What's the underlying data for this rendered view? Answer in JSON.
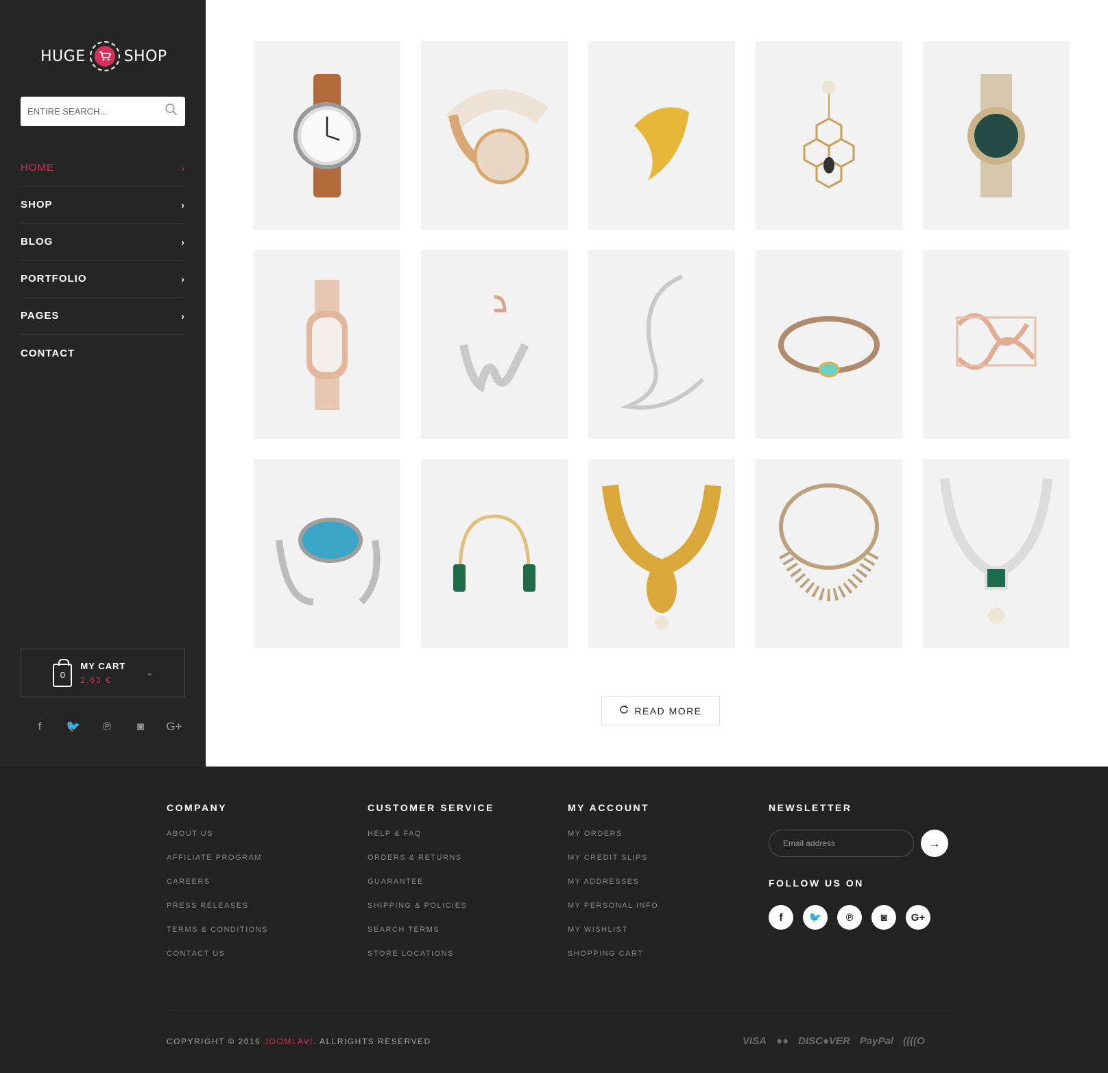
{
  "sidebar": {
    "logo": {
      "left": "HUGE",
      "right": "SHOP"
    },
    "search": {
      "placeholder": "ENTIRE SEARCH..."
    },
    "nav": [
      {
        "label": "HOME",
        "chevron": "›"
      },
      {
        "label": "SHOP",
        "chevron": "›"
      },
      {
        "label": "BLOG",
        "chevron": "›"
      },
      {
        "label": "PORTFOLIO",
        "chevron": "›"
      },
      {
        "label": "PAGES",
        "chevron": "›"
      },
      {
        "label": "CONTACT",
        "chevron": ""
      }
    ],
    "cart": {
      "title": "MY CART",
      "total": "2,63 €",
      "count": "0"
    },
    "social": [
      "f",
      "🐦",
      "℗",
      "◙",
      "G+"
    ]
  },
  "products": [
    "watch-leather",
    "watch-white-strap",
    "gold-cuff",
    "bee-earring",
    "green-dial-watch",
    "rose-gold-watch",
    "w-charm",
    "ear-cuff",
    "turquoise-bracelet",
    "rose-gold-ring",
    "turquoise-cuff",
    "malachite-bangle",
    "gold-necklace",
    "diamond-necklace",
    "emerald-necklace"
  ],
  "read_more": {
    "label": "READ MORE"
  },
  "footer": {
    "company": {
      "title": "COMPANY",
      "items": [
        "ABOUT US",
        "AFFILIATE PROGRAM",
        "CAREERS",
        "PRESS RELEASES",
        "TERMS & CONDITIONS",
        "CONTACT US"
      ]
    },
    "customer_service": {
      "title": "CUSTOMER SERVICE",
      "items": [
        "HELP & FAQ",
        "ORDERS & RETURNS",
        "GUARANTEE",
        "SHIPPING & POLICIES",
        "SEARCH TERMS",
        "STORE LOCATIONS"
      ]
    },
    "my_account": {
      "title": "MY ACCOUNT",
      "items": [
        "MY ORDERS",
        "MY CREDIT SLIPS",
        "MY ADDRESSES",
        "MY PERSONAL INFO",
        "MY WISHLIST",
        "SHOPPING CART"
      ]
    },
    "newsletter": {
      "title": "NEWSLETTER",
      "placeholder": "Email address",
      "button": "→"
    },
    "follow": {
      "title": "FOLLOW US ON",
      "icons": [
        "f",
        "🐦",
        "℗",
        "◙",
        "G+"
      ]
    },
    "copyright": {
      "prefix": "COPYRIGHT © 2016 ",
      "brand": "JOOMLAVI",
      "suffix": ". ALLRIGHTS RESERVED"
    },
    "payments": [
      "VISA",
      "●●",
      "DISC●VER",
      "PayPal",
      "((((O"
    ]
  },
  "colors": {
    "accent": "#d6315c",
    "sidebar_bg": "#252525",
    "footer_bg": "#222222"
  }
}
